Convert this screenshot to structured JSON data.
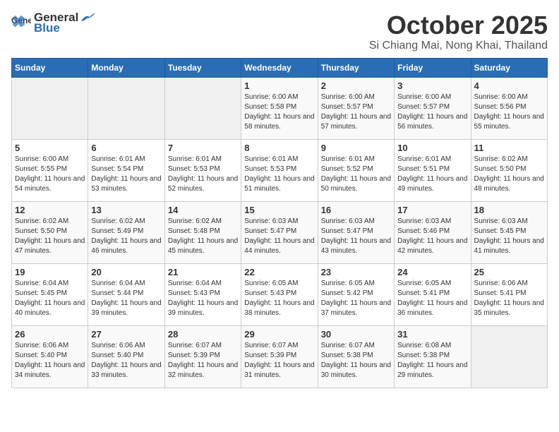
{
  "header": {
    "logo_general": "General",
    "logo_blue": "Blue",
    "month_title": "October 2025",
    "location": "Si Chiang Mai, Nong Khai, Thailand"
  },
  "weekdays": [
    "Sunday",
    "Monday",
    "Tuesday",
    "Wednesday",
    "Thursday",
    "Friday",
    "Saturday"
  ],
  "weeks": [
    [
      {
        "day": "",
        "sunrise": "",
        "sunset": "",
        "daylight": ""
      },
      {
        "day": "",
        "sunrise": "",
        "sunset": "",
        "daylight": ""
      },
      {
        "day": "",
        "sunrise": "",
        "sunset": "",
        "daylight": ""
      },
      {
        "day": "1",
        "sunrise": "Sunrise: 6:00 AM",
        "sunset": "Sunset: 5:58 PM",
        "daylight": "Daylight: 11 hours and 58 minutes."
      },
      {
        "day": "2",
        "sunrise": "Sunrise: 6:00 AM",
        "sunset": "Sunset: 5:57 PM",
        "daylight": "Daylight: 11 hours and 57 minutes."
      },
      {
        "day": "3",
        "sunrise": "Sunrise: 6:00 AM",
        "sunset": "Sunset: 5:57 PM",
        "daylight": "Daylight: 11 hours and 56 minutes."
      },
      {
        "day": "4",
        "sunrise": "Sunrise: 6:00 AM",
        "sunset": "Sunset: 5:56 PM",
        "daylight": "Daylight: 11 hours and 55 minutes."
      }
    ],
    [
      {
        "day": "5",
        "sunrise": "Sunrise: 6:00 AM",
        "sunset": "Sunset: 5:55 PM",
        "daylight": "Daylight: 11 hours and 54 minutes."
      },
      {
        "day": "6",
        "sunrise": "Sunrise: 6:01 AM",
        "sunset": "Sunset: 5:54 PM",
        "daylight": "Daylight: 11 hours and 53 minutes."
      },
      {
        "day": "7",
        "sunrise": "Sunrise: 6:01 AM",
        "sunset": "Sunset: 5:53 PM",
        "daylight": "Daylight: 11 hours and 52 minutes."
      },
      {
        "day": "8",
        "sunrise": "Sunrise: 6:01 AM",
        "sunset": "Sunset: 5:53 PM",
        "daylight": "Daylight: 11 hours and 51 minutes."
      },
      {
        "day": "9",
        "sunrise": "Sunrise: 6:01 AM",
        "sunset": "Sunset: 5:52 PM",
        "daylight": "Daylight: 11 hours and 50 minutes."
      },
      {
        "day": "10",
        "sunrise": "Sunrise: 6:01 AM",
        "sunset": "Sunset: 5:51 PM",
        "daylight": "Daylight: 11 hours and 49 minutes."
      },
      {
        "day": "11",
        "sunrise": "Sunrise: 6:02 AM",
        "sunset": "Sunset: 5:50 PM",
        "daylight": "Daylight: 11 hours and 48 minutes."
      }
    ],
    [
      {
        "day": "12",
        "sunrise": "Sunrise: 6:02 AM",
        "sunset": "Sunset: 5:50 PM",
        "daylight": "Daylight: 11 hours and 47 minutes."
      },
      {
        "day": "13",
        "sunrise": "Sunrise: 6:02 AM",
        "sunset": "Sunset: 5:49 PM",
        "daylight": "Daylight: 11 hours and 46 minutes."
      },
      {
        "day": "14",
        "sunrise": "Sunrise: 6:02 AM",
        "sunset": "Sunset: 5:48 PM",
        "daylight": "Daylight: 11 hours and 45 minutes."
      },
      {
        "day": "15",
        "sunrise": "Sunrise: 6:03 AM",
        "sunset": "Sunset: 5:47 PM",
        "daylight": "Daylight: 11 hours and 44 minutes."
      },
      {
        "day": "16",
        "sunrise": "Sunrise: 6:03 AM",
        "sunset": "Sunset: 5:47 PM",
        "daylight": "Daylight: 11 hours and 43 minutes."
      },
      {
        "day": "17",
        "sunrise": "Sunrise: 6:03 AM",
        "sunset": "Sunset: 5:46 PM",
        "daylight": "Daylight: 11 hours and 42 minutes."
      },
      {
        "day": "18",
        "sunrise": "Sunrise: 6:03 AM",
        "sunset": "Sunset: 5:45 PM",
        "daylight": "Daylight: 11 hours and 41 minutes."
      }
    ],
    [
      {
        "day": "19",
        "sunrise": "Sunrise: 6:04 AM",
        "sunset": "Sunset: 5:45 PM",
        "daylight": "Daylight: 11 hours and 40 minutes."
      },
      {
        "day": "20",
        "sunrise": "Sunrise: 6:04 AM",
        "sunset": "Sunset: 5:44 PM",
        "daylight": "Daylight: 11 hours and 39 minutes."
      },
      {
        "day": "21",
        "sunrise": "Sunrise: 6:04 AM",
        "sunset": "Sunset: 5:43 PM",
        "daylight": "Daylight: 11 hours and 39 minutes."
      },
      {
        "day": "22",
        "sunrise": "Sunrise: 6:05 AM",
        "sunset": "Sunset: 5:43 PM",
        "daylight": "Daylight: 11 hours and 38 minutes."
      },
      {
        "day": "23",
        "sunrise": "Sunrise: 6:05 AM",
        "sunset": "Sunset: 5:42 PM",
        "daylight": "Daylight: 11 hours and 37 minutes."
      },
      {
        "day": "24",
        "sunrise": "Sunrise: 6:05 AM",
        "sunset": "Sunset: 5:41 PM",
        "daylight": "Daylight: 11 hours and 36 minutes."
      },
      {
        "day": "25",
        "sunrise": "Sunrise: 6:06 AM",
        "sunset": "Sunset: 5:41 PM",
        "daylight": "Daylight: 11 hours and 35 minutes."
      }
    ],
    [
      {
        "day": "26",
        "sunrise": "Sunrise: 6:06 AM",
        "sunset": "Sunset: 5:40 PM",
        "daylight": "Daylight: 11 hours and 34 minutes."
      },
      {
        "day": "27",
        "sunrise": "Sunrise: 6:06 AM",
        "sunset": "Sunset: 5:40 PM",
        "daylight": "Daylight: 11 hours and 33 minutes."
      },
      {
        "day": "28",
        "sunrise": "Sunrise: 6:07 AM",
        "sunset": "Sunset: 5:39 PM",
        "daylight": "Daylight: 11 hours and 32 minutes."
      },
      {
        "day": "29",
        "sunrise": "Sunrise: 6:07 AM",
        "sunset": "Sunset: 5:39 PM",
        "daylight": "Daylight: 11 hours and 31 minutes."
      },
      {
        "day": "30",
        "sunrise": "Sunrise: 6:07 AM",
        "sunset": "Sunset: 5:38 PM",
        "daylight": "Daylight: 11 hours and 30 minutes."
      },
      {
        "day": "31",
        "sunrise": "Sunrise: 6:08 AM",
        "sunset": "Sunset: 5:38 PM",
        "daylight": "Daylight: 11 hours and 29 minutes."
      },
      {
        "day": "",
        "sunrise": "",
        "sunset": "",
        "daylight": ""
      }
    ]
  ]
}
